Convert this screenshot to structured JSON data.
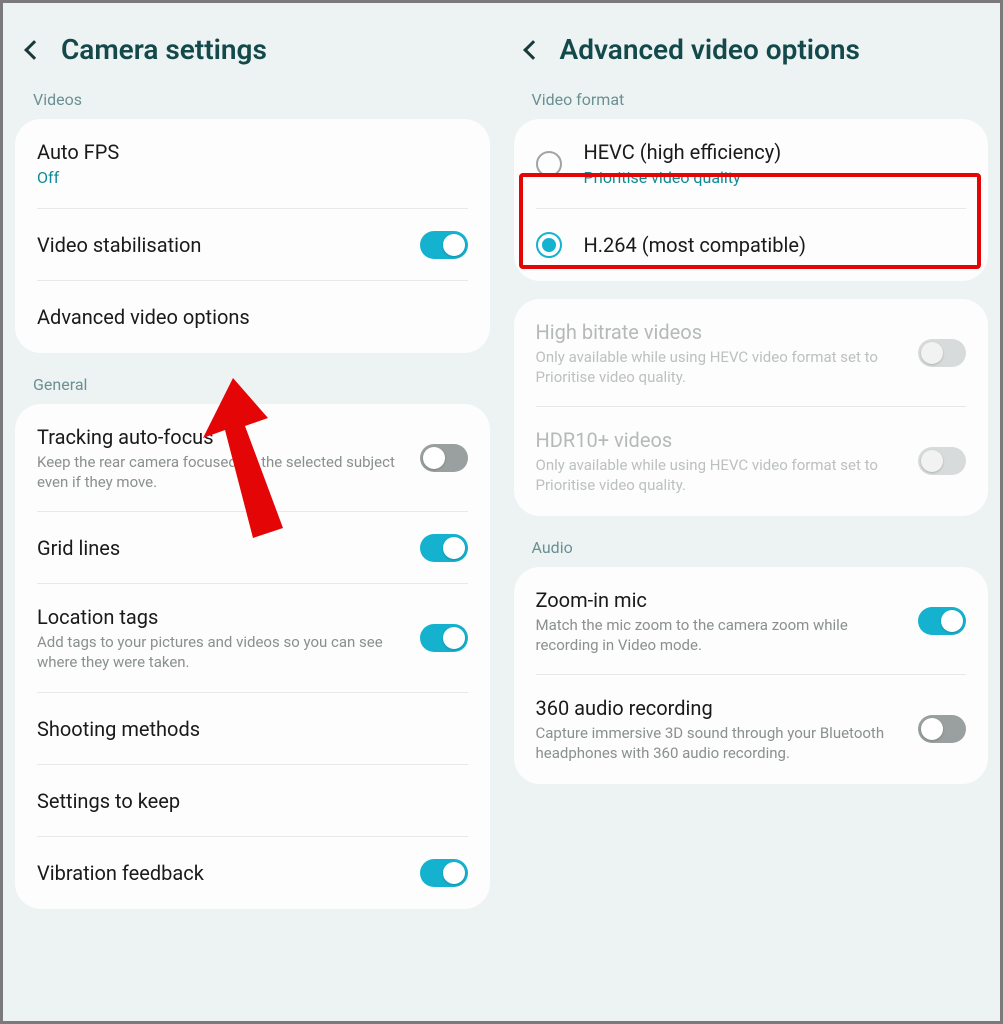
{
  "left": {
    "title": "Camera settings",
    "sections": {
      "videos": {
        "label": "Videos",
        "auto_fps": {
          "title": "Auto FPS",
          "sub": "Off"
        },
        "video_stab": {
          "title": "Video stabilisation"
        },
        "adv_video": {
          "title": "Advanced video options"
        }
      },
      "general": {
        "label": "General",
        "tracking_af": {
          "title": "Tracking auto-focus",
          "sub": "Keep the rear camera focused on the selected subject even if they move."
        },
        "grid": {
          "title": "Grid lines"
        },
        "location": {
          "title": "Location tags",
          "sub": "Add tags to your pictures and videos so you can see where they were taken."
        },
        "shooting": {
          "title": "Shooting methods"
        },
        "settings_keep": {
          "title": "Settings to keep"
        },
        "vibration": {
          "title": "Vibration feedback"
        }
      }
    }
  },
  "right": {
    "title": "Advanced video options",
    "sections": {
      "video_format": {
        "label": "Video format",
        "hevc": {
          "title": "HEVC (high efficiency)",
          "sub": "Prioritise video quality"
        },
        "h264": {
          "title": "H.264 (most compatible)"
        }
      },
      "features": {
        "high_bitrate": {
          "title": "High bitrate videos",
          "sub": "Only available while using HEVC video format set to Prioritise video quality."
        },
        "hdr10": {
          "title": "HDR10+ videos",
          "sub": "Only available while using HEVC video format set to Prioritise video quality."
        }
      },
      "audio": {
        "label": "Audio",
        "zoom_mic": {
          "title": "Zoom-in mic",
          "sub": "Match the mic zoom to the camera zoom while recording in Video mode."
        },
        "audio360": {
          "title": "360 audio recording",
          "sub": "Capture immersive 3D sound through your Bluetooth headphones with 360 audio recording."
        }
      }
    }
  }
}
